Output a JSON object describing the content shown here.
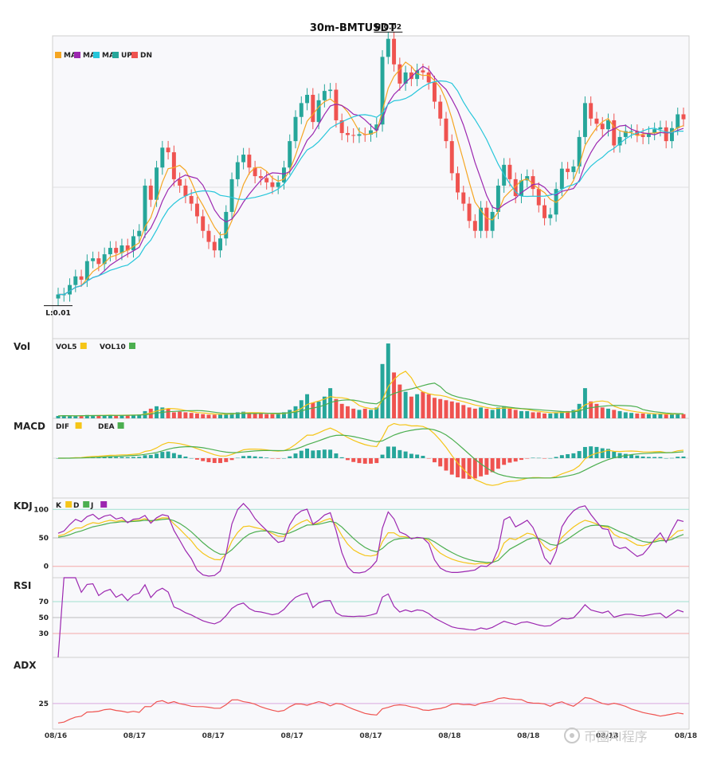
{
  "chart_data": {
    "type": "candlestick",
    "title": "30m-BMTUSDT",
    "x_tick_labels": [
      "08/16",
      "08/17",
      "08/17",
      "08/17",
      "08/17",
      "08/18",
      "08/18",
      "08/18",
      "08/18"
    ],
    "price": {
      "legend": [
        {
          "label": "MA",
          "color": "#f5a623"
        },
        {
          "label": "MA",
          "color": "#9c27b0"
        },
        {
          "label": "MA",
          "color": "#26c6da"
        },
        {
          "label": "UP",
          "color": "#26a69a"
        },
        {
          "label": "DN",
          "color": "#ef5350"
        }
      ],
      "high_label": "H:0.02",
      "low_label": "L:0.01"
    },
    "panels": [
      {
        "label": "Vol",
        "legend": [
          {
            "label": "VOL5",
            "color": "#f5c518"
          },
          {
            "label": "VOL10",
            "color": "#4caf50"
          }
        ]
      },
      {
        "label": "MACD",
        "legend": [
          {
            "label": "DIF",
            "color": "#f5c518"
          },
          {
            "label": "DEA",
            "color": "#4caf50"
          }
        ]
      },
      {
        "label": "KDJ",
        "legend": [
          {
            "label": "K",
            "color": "#f5c518"
          },
          {
            "label": "D",
            "color": "#4caf50"
          },
          {
            "label": "J",
            "color": "#9c27b0"
          }
        ],
        "ticks": [
          "100",
          "50",
          "0"
        ]
      },
      {
        "label": "RSI",
        "ticks": [
          "70",
          "50",
          "30"
        ]
      },
      {
        "label": "ADX",
        "ticks": [
          "25"
        ]
      }
    ],
    "close": [
      0.005,
      0.005,
      0.0055,
      0.006,
      0.0058,
      0.007,
      0.0072,
      0.0068,
      0.0075,
      0.008,
      0.0076,
      0.0082,
      0.0078,
      0.009,
      0.0095,
      0.015,
      0.013,
      0.018,
      0.022,
      0.021,
      0.016,
      0.015,
      0.0135,
      0.0125,
      0.011,
      0.0095,
      0.0085,
      0.0078,
      0.0088,
      0.0115,
      0.016,
      0.019,
      0.0205,
      0.018,
      0.0165,
      0.0162,
      0.0155,
      0.0148,
      0.0155,
      0.018,
      0.0235,
      0.03,
      0.0345,
      0.0375,
      0.0285,
      0.0355,
      0.039,
      0.0395,
      0.029,
      0.0255,
      0.025,
      0.0248,
      0.0252,
      0.0251,
      0.0262,
      0.0278,
      0.055,
      0.066,
      0.051,
      0.042,
      0.047,
      0.044,
      0.048,
      0.047,
      0.0425,
      0.035,
      0.0295,
      0.0235,
      0.017,
      0.014,
      0.0125,
      0.0105,
      0.0095,
      0.012,
      0.0095,
      0.0115,
      0.015,
      0.0185,
      0.016,
      0.0135,
      0.0158,
      0.0165,
      0.0145,
      0.0123,
      0.0108,
      0.0112,
      0.0145,
      0.0178,
      0.0172,
      0.0182,
      0.0245,
      0.0345,
      0.0295,
      0.028,
      0.0265,
      0.029,
      0.0225,
      0.0245,
      0.026,
      0.026,
      0.025,
      0.0245,
      0.0255,
      0.0265,
      0.027,
      0.0235,
      0.0268,
      0.0308,
      0.0293
    ],
    "open": [
      0.0048,
      0.005,
      0.005,
      0.0055,
      0.006,
      0.0058,
      0.007,
      0.0072,
      0.0068,
      0.0075,
      0.008,
      0.0076,
      0.0082,
      0.0078,
      0.009,
      0.0095,
      0.015,
      0.013,
      0.018,
      0.022,
      0.021,
      0.016,
      0.015,
      0.0135,
      0.0125,
      0.011,
      0.0095,
      0.0085,
      0.0078,
      0.0088,
      0.0115,
      0.016,
      0.019,
      0.0205,
      0.018,
      0.0165,
      0.0162,
      0.0155,
      0.0148,
      0.0155,
      0.018,
      0.0235,
      0.03,
      0.0345,
      0.0375,
      0.0285,
      0.0355,
      0.039,
      0.0395,
      0.029,
      0.0255,
      0.025,
      0.0248,
      0.0252,
      0.0251,
      0.0262,
      0.0278,
      0.055,
      0.066,
      0.051,
      0.042,
      0.047,
      0.044,
      0.048,
      0.047,
      0.0425,
      0.035,
      0.0295,
      0.0235,
      0.017,
      0.014,
      0.0125,
      0.0105,
      0.0095,
      0.012,
      0.0095,
      0.0115,
      0.015,
      0.0185,
      0.016,
      0.0135,
      0.0158,
      0.0165,
      0.0145,
      0.0123,
      0.0108,
      0.0112,
      0.0145,
      0.0178,
      0.0172,
      0.0182,
      0.0245,
      0.0345,
      0.0295,
      0.028,
      0.0265,
      0.029,
      0.0225,
      0.0245,
      0.026,
      0.026,
      0.025,
      0.0245,
      0.0255,
      0.0265,
      0.027,
      0.0235,
      0.0268,
      0.0308
    ],
    "volume": [
      2,
      2.5,
      2,
      2,
      2.3,
      2.8,
      2.5,
      2.2,
      2.6,
      3,
      2.4,
      2.7,
      2.5,
      3,
      3.2,
      6,
      8,
      10,
      9,
      8,
      5,
      5.5,
      5,
      4.5,
      4,
      3.5,
      3,
      3,
      3.5,
      4,
      4.5,
      5,
      5.5,
      4.5,
      4,
      4,
      3.5,
      3.5,
      4,
      5,
      7,
      10,
      15,
      20,
      13,
      14,
      18,
      25,
      16,
      12,
      10,
      8,
      7,
      8,
      7,
      9,
      45,
      62,
      38,
      28,
      22,
      18,
      20,
      22,
      20,
      17,
      16,
      15,
      14,
      13,
      11,
      9,
      8,
      9,
      8,
      7,
      9,
      10,
      8,
      7,
      6,
      6,
      5,
      5,
      4,
      4,
      5,
      6,
      6,
      7,
      12,
      25,
      14,
      12,
      9,
      8,
      7,
      6,
      5,
      4.5,
      4,
      4,
      3.5,
      3.5,
      3.8,
      3.2,
      3.5,
      4,
      3.5
    ]
  }
}
